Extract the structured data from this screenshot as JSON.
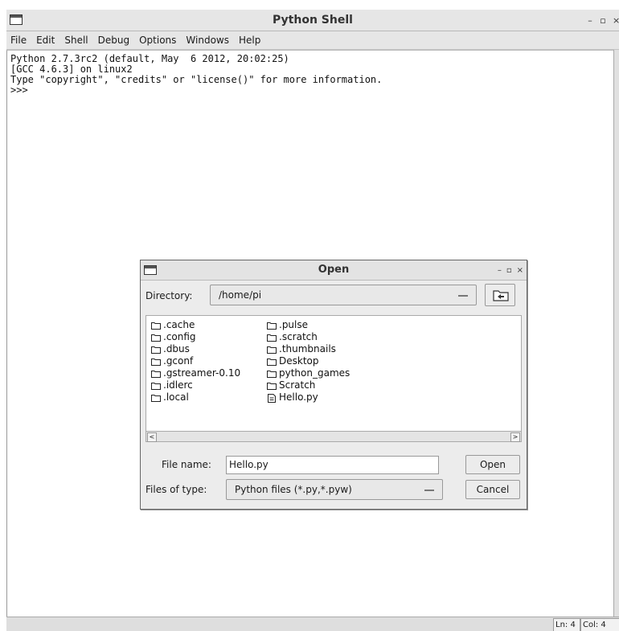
{
  "window": {
    "title": "Python Shell",
    "controls": {
      "minimize": "–",
      "maximize": "▫",
      "close": "×"
    }
  },
  "menu": [
    "File",
    "Edit",
    "Shell",
    "Debug",
    "Options",
    "Windows",
    "Help"
  ],
  "shell": {
    "lines": [
      "Python 2.7.3rc2 (default, May  6 2012, 20:02:25)",
      "[GCC 4.6.3] on linux2",
      "Type \"copyright\", \"credits\" or \"license()\" for more information.",
      ">>>"
    ]
  },
  "status": {
    "ln": "Ln: 4",
    "col": "Col: 4"
  },
  "dialog": {
    "title": "Open",
    "controls": {
      "minimize": "–",
      "maximize": "▫",
      "close": "×"
    },
    "directory_label": "Directory:",
    "directory_value": "/home/pi",
    "files_col1": [
      ".cache",
      ".config",
      ".dbus",
      ".gconf",
      ".gstreamer-0.10",
      ".idlerc",
      ".local"
    ],
    "files_col2": [
      ".pulse",
      ".scratch",
      ".thumbnails",
      "Desktop",
      "python_games",
      "Scratch",
      "Hello.py"
    ],
    "file_name_label": "File name:",
    "file_name_value": "Hello.py",
    "files_of_type_label": "Files of type:",
    "files_of_type_value": "Python files (*.py,*.pyw)",
    "open_button": "Open",
    "cancel_button": "Cancel"
  }
}
